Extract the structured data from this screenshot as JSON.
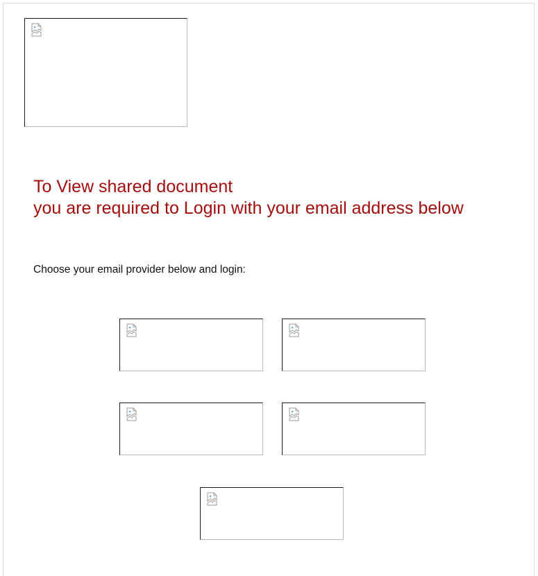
{
  "header": {
    "logo_icon": "broken-image-icon"
  },
  "main": {
    "headline_line1": "To View shared document",
    "headline_line2": "you are required to Login with your email address below",
    "instruction": "Choose your email provider below and login:",
    "headline_color": "#a30d0d"
  },
  "providers": {
    "count": 5,
    "icon": "broken-image-icon"
  }
}
